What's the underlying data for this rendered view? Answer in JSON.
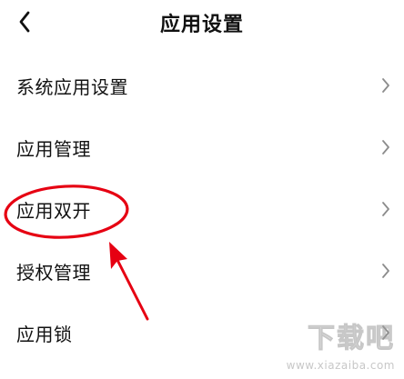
{
  "header": {
    "title": "应用设置",
    "back_icon": "chevron-left-icon"
  },
  "menu": {
    "items": [
      {
        "label": "系统应用设置",
        "icon": "chevron-right-icon"
      },
      {
        "label": "应用管理",
        "icon": "chevron-right-icon"
      },
      {
        "label": "应用双开",
        "icon": "chevron-right-icon",
        "highlighted": true
      },
      {
        "label": "授权管理",
        "icon": "chevron-right-icon"
      },
      {
        "label": "应用锁",
        "icon": "chevron-right-icon"
      }
    ]
  },
  "annotation": {
    "color": "#e60012",
    "target": "应用双开"
  },
  "watermark": {
    "text": "下载吧",
    "subtext": "www.xiazaiba.com"
  }
}
